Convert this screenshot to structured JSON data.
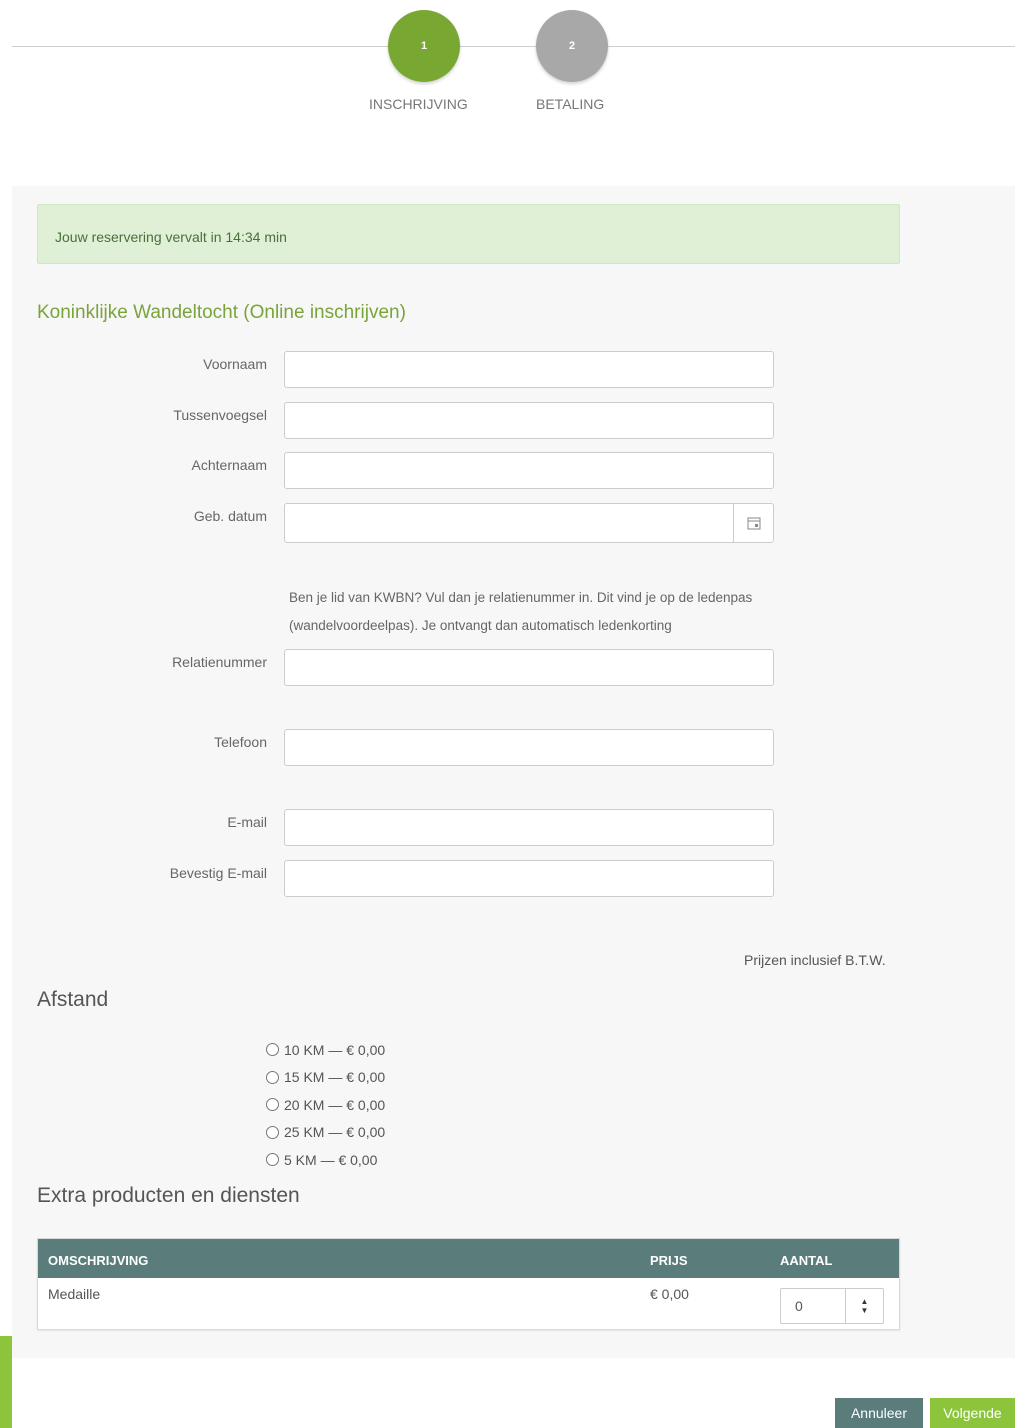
{
  "stepper": {
    "steps": [
      {
        "number": "1",
        "label": "INSCHRIJVING",
        "active": true
      },
      {
        "number": "2",
        "label": "BETALING",
        "active": false
      }
    ],
    "active_color": "#78a832",
    "inactive_color": "#a8a8a8"
  },
  "alert": {
    "text": "Jouw reservering vervalt in 14:34 min"
  },
  "event_title": "Koninklijke Wandeltocht (Online inschrijven)",
  "form": {
    "first_name": {
      "label": "Voornaam",
      "value": ""
    },
    "infix": {
      "label": "Tussenvoegsel",
      "value": ""
    },
    "last_name": {
      "label": "Achternaam",
      "value": ""
    },
    "birth_date": {
      "label": "Geb. datum",
      "value": ""
    },
    "membership_help": "Ben je lid van KWBN? Vul dan je relatienummer in. Dit vind je op de ledenpas (wandelvoordeelpas). Je ontvangt dan automatisch ledenkorting",
    "relation_number": {
      "label": "Relatienummer",
      "value": ""
    },
    "phone": {
      "label": "Telefoon",
      "value": ""
    },
    "email": {
      "label": "E-mail",
      "value": ""
    },
    "email_confirm": {
      "label": "Bevestig E-mail",
      "value": ""
    }
  },
  "vat_note": "Prijzen inclusief B.T.W.",
  "distance": {
    "heading": "Afstand",
    "options": [
      "10 KM — € 0,00",
      "15 KM — € 0,00",
      "20 KM — € 0,00",
      "25 KM — € 0,00",
      "5 KM — € 0,00"
    ]
  },
  "extras": {
    "heading": "Extra producten en diensten",
    "columns": {
      "description": "OMSCHRIJVING",
      "price": "PRIJS",
      "quantity": "AANTAL"
    },
    "rows": [
      {
        "description": "Medaille",
        "price": "€ 0,00",
        "quantity": "0"
      }
    ]
  },
  "actions": {
    "cancel": "Annuleer",
    "next": "Volgende"
  },
  "colors": {
    "brand_green": "#8cc43c",
    "title_green": "#7aa43a",
    "table_header": "#5a7d7b",
    "alert_bg": "#dff0d6"
  }
}
